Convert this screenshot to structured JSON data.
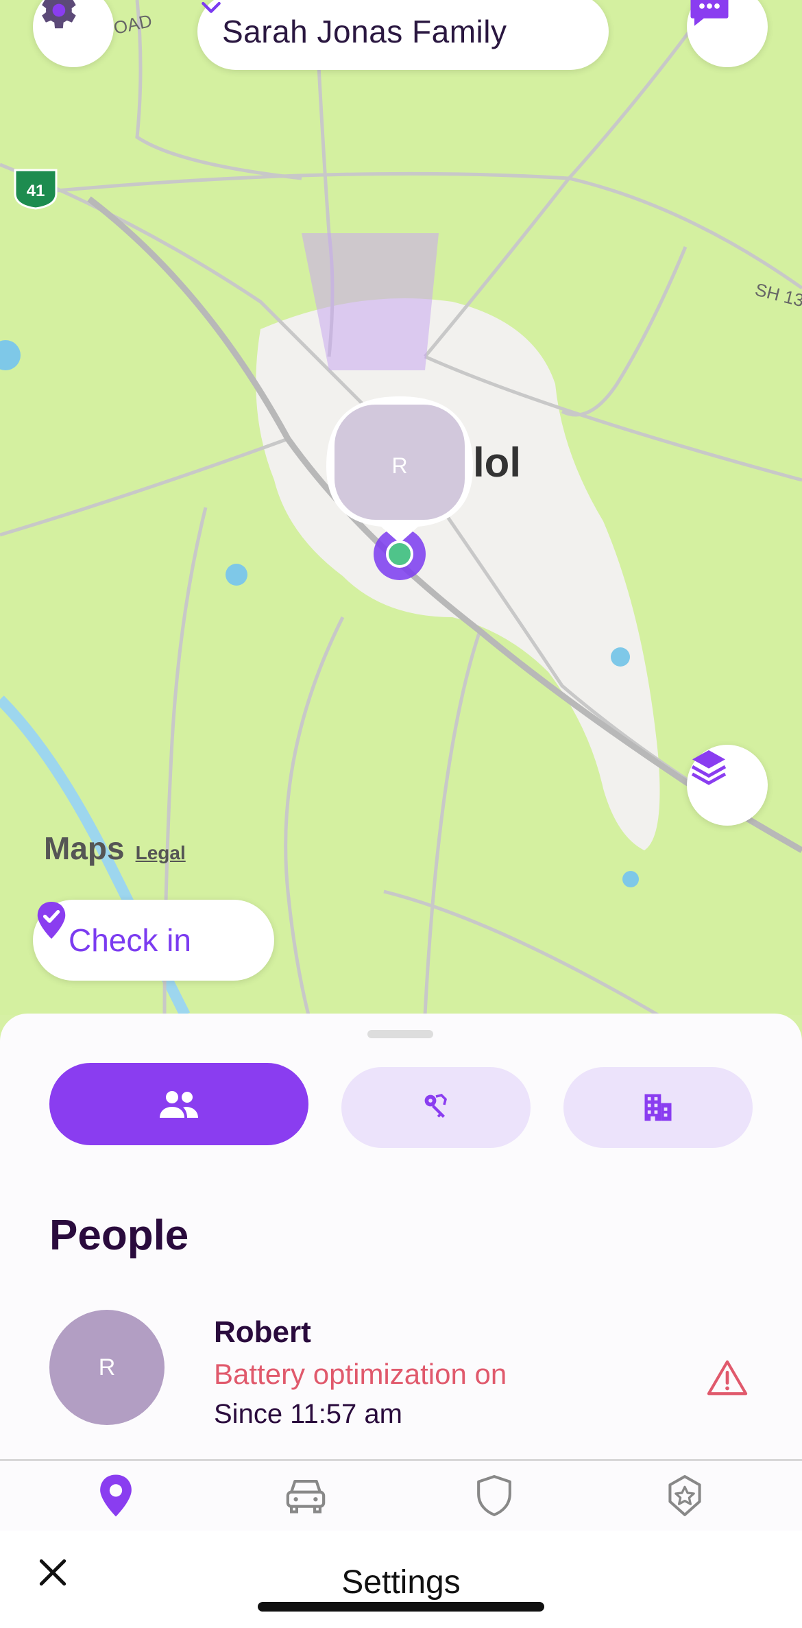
{
  "header": {
    "family_name": "Sarah Jonas Family",
    "settings_icon": "gear-icon",
    "dropdown_icon": "chevron-down-icon",
    "chat_icon": "chat-bubble-icon"
  },
  "map": {
    "road_label_top": "OAD",
    "highway_shield": "41",
    "road_label_right": "SH 13",
    "city_label": "lol",
    "marker_initial": "R",
    "maps_logo": "Maps",
    "legal_link": "Legal",
    "layers_icon": "layers-icon",
    "check_in_label": "Check in"
  },
  "segments": [
    {
      "icon": "people-icon",
      "active": true
    },
    {
      "icon": "keys-icon",
      "active": false
    },
    {
      "icon": "buildings-icon",
      "active": false
    }
  ],
  "people": {
    "title": "People",
    "items": [
      {
        "initial": "R",
        "name": "Robert",
        "status": "Battery optimization on",
        "since": "Since 11:57 am"
      }
    ]
  },
  "tabs": [
    {
      "icon": "location-pin-icon",
      "active": true
    },
    {
      "icon": "car-icon",
      "active": false
    },
    {
      "icon": "shield-icon",
      "active": false
    },
    {
      "icon": "star-badge-icon",
      "active": false
    }
  ],
  "bottom_bar": {
    "title": "Settings",
    "close_icon": "close-icon"
  },
  "colors": {
    "accent": "#8a3df0",
    "map_green": "#d4f0a0",
    "warning": "#e0596c",
    "text_dark": "#2a0b3d"
  }
}
